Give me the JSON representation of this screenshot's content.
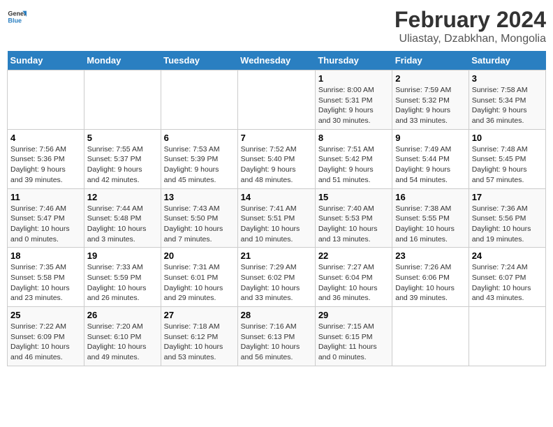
{
  "header": {
    "logo_general": "General",
    "logo_blue": "Blue",
    "title": "February 2024",
    "subtitle": "Uliastay, Dzabkhan, Mongolia"
  },
  "weekdays": [
    "Sunday",
    "Monday",
    "Tuesday",
    "Wednesday",
    "Thursday",
    "Friday",
    "Saturday"
  ],
  "weeks": [
    [
      {
        "day": "",
        "info": ""
      },
      {
        "day": "",
        "info": ""
      },
      {
        "day": "",
        "info": ""
      },
      {
        "day": "",
        "info": ""
      },
      {
        "day": "1",
        "info": "Sunrise: 8:00 AM\nSunset: 5:31 PM\nDaylight: 9 hours\nand 30 minutes."
      },
      {
        "day": "2",
        "info": "Sunrise: 7:59 AM\nSunset: 5:32 PM\nDaylight: 9 hours\nand 33 minutes."
      },
      {
        "day": "3",
        "info": "Sunrise: 7:58 AM\nSunset: 5:34 PM\nDaylight: 9 hours\nand 36 minutes."
      }
    ],
    [
      {
        "day": "4",
        "info": "Sunrise: 7:56 AM\nSunset: 5:36 PM\nDaylight: 9 hours\nand 39 minutes."
      },
      {
        "day": "5",
        "info": "Sunrise: 7:55 AM\nSunset: 5:37 PM\nDaylight: 9 hours\nand 42 minutes."
      },
      {
        "day": "6",
        "info": "Sunrise: 7:53 AM\nSunset: 5:39 PM\nDaylight: 9 hours\nand 45 minutes."
      },
      {
        "day": "7",
        "info": "Sunrise: 7:52 AM\nSunset: 5:40 PM\nDaylight: 9 hours\nand 48 minutes."
      },
      {
        "day": "8",
        "info": "Sunrise: 7:51 AM\nSunset: 5:42 PM\nDaylight: 9 hours\nand 51 minutes."
      },
      {
        "day": "9",
        "info": "Sunrise: 7:49 AM\nSunset: 5:44 PM\nDaylight: 9 hours\nand 54 minutes."
      },
      {
        "day": "10",
        "info": "Sunrise: 7:48 AM\nSunset: 5:45 PM\nDaylight: 9 hours\nand 57 minutes."
      }
    ],
    [
      {
        "day": "11",
        "info": "Sunrise: 7:46 AM\nSunset: 5:47 PM\nDaylight: 10 hours\nand 0 minutes."
      },
      {
        "day": "12",
        "info": "Sunrise: 7:44 AM\nSunset: 5:48 PM\nDaylight: 10 hours\nand 3 minutes."
      },
      {
        "day": "13",
        "info": "Sunrise: 7:43 AM\nSunset: 5:50 PM\nDaylight: 10 hours\nand 7 minutes."
      },
      {
        "day": "14",
        "info": "Sunrise: 7:41 AM\nSunset: 5:51 PM\nDaylight: 10 hours\nand 10 minutes."
      },
      {
        "day": "15",
        "info": "Sunrise: 7:40 AM\nSunset: 5:53 PM\nDaylight: 10 hours\nand 13 minutes."
      },
      {
        "day": "16",
        "info": "Sunrise: 7:38 AM\nSunset: 5:55 PM\nDaylight: 10 hours\nand 16 minutes."
      },
      {
        "day": "17",
        "info": "Sunrise: 7:36 AM\nSunset: 5:56 PM\nDaylight: 10 hours\nand 19 minutes."
      }
    ],
    [
      {
        "day": "18",
        "info": "Sunrise: 7:35 AM\nSunset: 5:58 PM\nDaylight: 10 hours\nand 23 minutes."
      },
      {
        "day": "19",
        "info": "Sunrise: 7:33 AM\nSunset: 5:59 PM\nDaylight: 10 hours\nand 26 minutes."
      },
      {
        "day": "20",
        "info": "Sunrise: 7:31 AM\nSunset: 6:01 PM\nDaylight: 10 hours\nand 29 minutes."
      },
      {
        "day": "21",
        "info": "Sunrise: 7:29 AM\nSunset: 6:02 PM\nDaylight: 10 hours\nand 33 minutes."
      },
      {
        "day": "22",
        "info": "Sunrise: 7:27 AM\nSunset: 6:04 PM\nDaylight: 10 hours\nand 36 minutes."
      },
      {
        "day": "23",
        "info": "Sunrise: 7:26 AM\nSunset: 6:06 PM\nDaylight: 10 hours\nand 39 minutes."
      },
      {
        "day": "24",
        "info": "Sunrise: 7:24 AM\nSunset: 6:07 PM\nDaylight: 10 hours\nand 43 minutes."
      }
    ],
    [
      {
        "day": "25",
        "info": "Sunrise: 7:22 AM\nSunset: 6:09 PM\nDaylight: 10 hours\nand 46 minutes."
      },
      {
        "day": "26",
        "info": "Sunrise: 7:20 AM\nSunset: 6:10 PM\nDaylight: 10 hours\nand 49 minutes."
      },
      {
        "day": "27",
        "info": "Sunrise: 7:18 AM\nSunset: 6:12 PM\nDaylight: 10 hours\nand 53 minutes."
      },
      {
        "day": "28",
        "info": "Sunrise: 7:16 AM\nSunset: 6:13 PM\nDaylight: 10 hours\nand 56 minutes."
      },
      {
        "day": "29",
        "info": "Sunrise: 7:15 AM\nSunset: 6:15 PM\nDaylight: 11 hours\nand 0 minutes."
      },
      {
        "day": "",
        "info": ""
      },
      {
        "day": "",
        "info": ""
      }
    ]
  ]
}
